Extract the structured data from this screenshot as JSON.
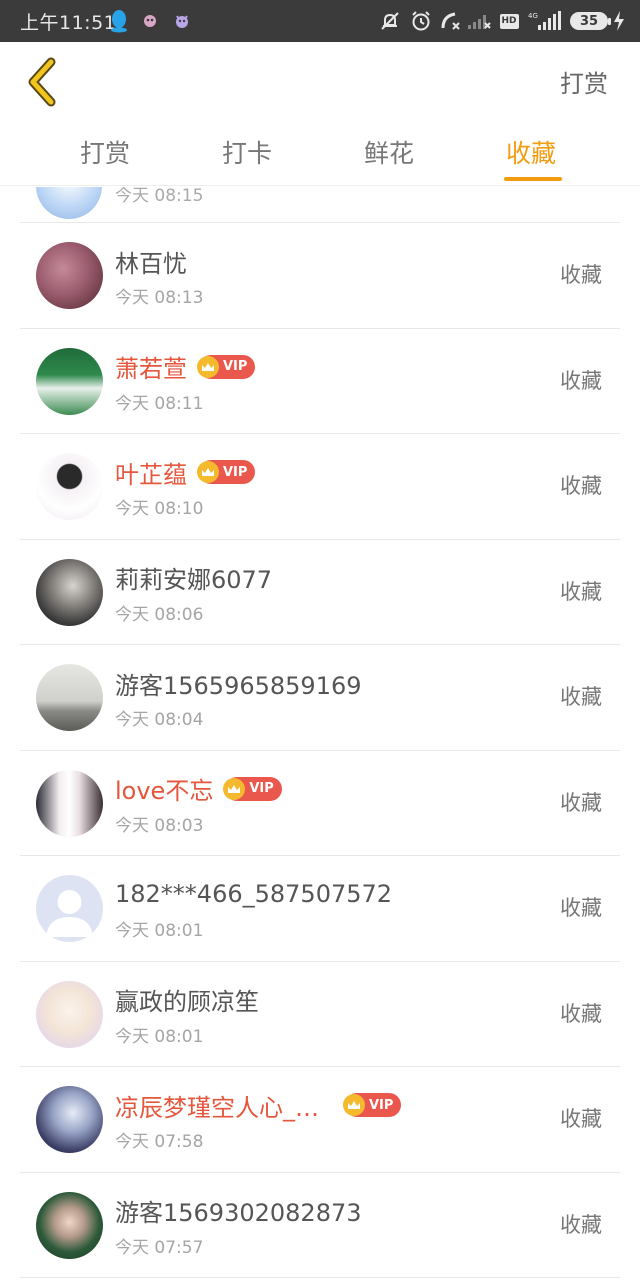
{
  "status_bar": {
    "time": "上午11:51",
    "battery": "35",
    "hd_label": "HD",
    "colors": {
      "background": "#3b3b3b",
      "qq": "#29a3e8"
    }
  },
  "header": {
    "back_icon": "chevron-left-icon",
    "right_label": "打赏",
    "accent_color": "#f39c12"
  },
  "tabs": [
    {
      "label": "打赏",
      "active": false
    },
    {
      "label": "打卡",
      "active": false
    },
    {
      "label": "鲜花",
      "active": false
    },
    {
      "label": "收藏",
      "active": true
    }
  ],
  "list": {
    "partial_top": {
      "time": "今天 08:15"
    },
    "items": [
      {
        "name": "林百忧",
        "time": "今天 08:13",
        "vip": false,
        "action": "收藏"
      },
      {
        "name": "萧若萱",
        "time": "今天 08:11",
        "vip": true,
        "vip_label": "VIP",
        "action": "收藏"
      },
      {
        "name": "叶芷蕴",
        "time": "今天 08:10",
        "vip": true,
        "vip_label": "VIP",
        "action": "收藏"
      },
      {
        "name": "莉莉安娜6077",
        "time": "今天 08:06",
        "vip": false,
        "action": "收藏"
      },
      {
        "name": "游客1565965859169",
        "time": "今天 08:04",
        "vip": false,
        "action": "收藏"
      },
      {
        "name": "love不忘",
        "time": "今天 08:03",
        "vip": true,
        "vip_label": "VIP",
        "action": "收藏"
      },
      {
        "name": "182***466_587507572",
        "time": "今天 08:01",
        "vip": false,
        "action": "收藏"
      },
      {
        "name": "赢政的顾凉笙",
        "time": "今天 08:01",
        "vip": false,
        "action": "收藏"
      },
      {
        "name": "凉辰梦瑾空人心_…",
        "time": "今天 07:58",
        "vip": true,
        "vip_label": "VIP",
        "action": "收藏"
      },
      {
        "name": "游客1569302082873",
        "time": "今天 07:57",
        "vip": false,
        "action": "收藏"
      }
    ]
  }
}
